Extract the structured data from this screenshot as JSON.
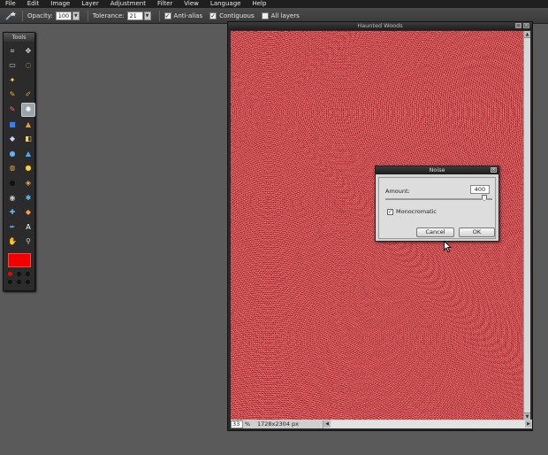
{
  "menu": [
    "File",
    "Edit",
    "Image",
    "Layer",
    "Adjustment",
    "Filter",
    "View",
    "Language",
    "Help"
  ],
  "options": {
    "tool_icon": "magic-wand-icon",
    "opacity_label": "Opacity:",
    "opacity_value": "100",
    "tolerance_label": "Tolerance:",
    "tolerance_value": "21",
    "antialias_label": "Anti-alias",
    "antialias_checked": true,
    "contiguous_label": "Contiguous",
    "contiguous_checked": true,
    "all_layers_label": "All layers",
    "all_layers_checked": false
  },
  "tools": {
    "title": "Tools",
    "items": [
      {
        "name": "crop-icon",
        "glyph": "⌗",
        "color": "#dddddd"
      },
      {
        "name": "move-icon",
        "glyph": "✥",
        "color": "#dddddd"
      },
      {
        "name": "rect-select-icon",
        "glyph": "▭",
        "color": "#cccccc"
      },
      {
        "name": "lasso-icon",
        "glyph": "◌",
        "color": "#e0c070"
      },
      {
        "name": "magic-wand-icon-small",
        "glyph": "✦",
        "color": "#ffd860"
      },
      {
        "name": "blank",
        "glyph": "",
        "color": "#000000"
      },
      {
        "name": "pencil-icon",
        "glyph": "✎",
        "color": "#f0b030"
      },
      {
        "name": "brush-icon",
        "glyph": "✐",
        "color": "#d09040"
      },
      {
        "name": "eraser-icon",
        "glyph": "✎",
        "color": "#ff6080"
      },
      {
        "name": "magic-wand-icon",
        "glyph": "✺",
        "color": "#ffffff",
        "active": true
      },
      {
        "name": "gradient-icon",
        "glyph": "■",
        "color": "#3080ff"
      },
      {
        "name": "stamp-icon",
        "glyph": "▲",
        "color": "#e0a040"
      },
      {
        "name": "paint-bucket-icon",
        "glyph": "◆",
        "color": "#d0d0ff"
      },
      {
        "name": "replace-color-icon",
        "glyph": "◧",
        "color": "#ffd060"
      },
      {
        "name": "drop-icon",
        "glyph": "●",
        "color": "#60b0ff"
      },
      {
        "name": "sharpen-icon",
        "glyph": "▲",
        "color": "#40b0ff"
      },
      {
        "name": "smudge-icon",
        "glyph": "◍",
        "color": "#f0a040"
      },
      {
        "name": "sponge-icon",
        "glyph": "●",
        "color": "#ffd020"
      },
      {
        "name": "dodge-icon",
        "glyph": "●",
        "color": "#111111"
      },
      {
        "name": "burn-icon",
        "glyph": "◈",
        "color": "#f0b040"
      },
      {
        "name": "red-eye-icon",
        "glyph": "◉",
        "color": "#cccccc"
      },
      {
        "name": "spot-heal-icon",
        "glyph": "✱",
        "color": "#50c0ff"
      },
      {
        "name": "bloat-icon",
        "glyph": "✚",
        "color": "#60b8ff"
      },
      {
        "name": "pinch-icon",
        "glyph": "◆",
        "color": "#f0a050"
      },
      {
        "name": "color-picker-icon",
        "glyph": "✒",
        "color": "#60a0ff"
      },
      {
        "name": "type-icon",
        "glyph": "A",
        "color": "#ffffff"
      },
      {
        "name": "hand-icon",
        "glyph": "✋",
        "color": "#f0c070"
      },
      {
        "name": "zoom-icon",
        "glyph": "⚲",
        "color": "#cccccc"
      }
    ],
    "foreground_color": "#f20000",
    "color_dots": [
      "#f20000",
      "#111111",
      "#111111",
      "#111111",
      "#111111",
      "#111111"
    ]
  },
  "document": {
    "title": "Haunted Woods",
    "zoom": "33",
    "zoom_unit": "%",
    "dimensions": "1728x2304 px"
  },
  "dialog": {
    "title": "Noise",
    "amount_label": "Amount:",
    "amount_value": "400",
    "monochromatic_label": "Monocromatic",
    "monochromatic_checked": true,
    "cancel_label": "Cancel",
    "ok_label": "OK"
  }
}
